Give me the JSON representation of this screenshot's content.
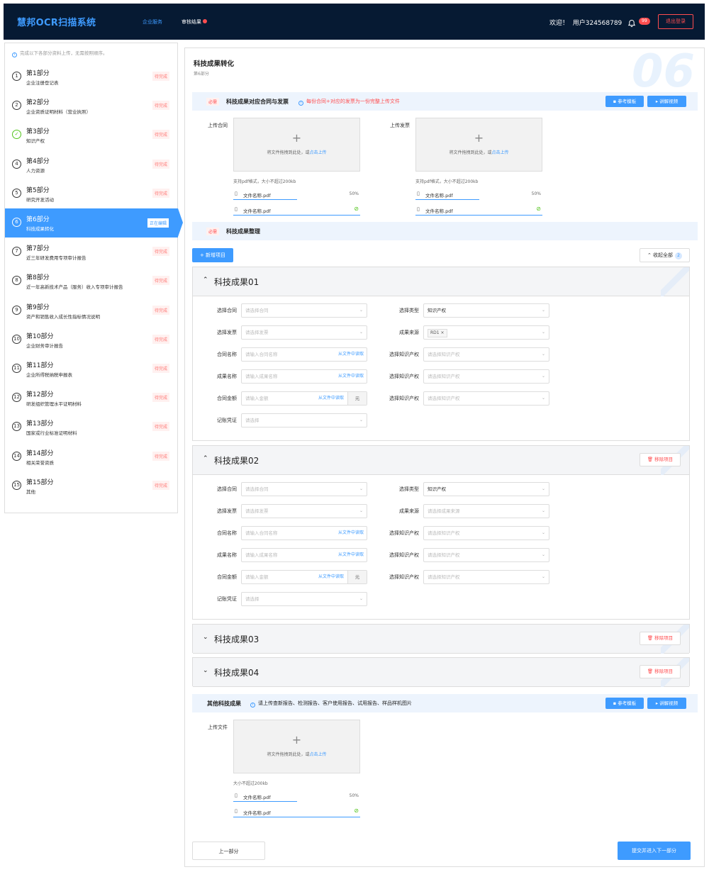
{
  "header": {
    "logo": "慧邦OCR扫描系统",
    "nav": [
      {
        "label": "企业服务",
        "active": true
      },
      {
        "label": "审核结果",
        "active": false
      }
    ],
    "welcome": "欢迎！",
    "user": "用户324568789",
    "badge": "99",
    "logout": "退出登录"
  },
  "sidebar": {
    "tip": "完成以下各部分资料上传，无需按照顺序。",
    "items": [
      {
        "num": "1",
        "title": "第1部分",
        "sub": "企业注册登记表",
        "status": "待完成"
      },
      {
        "num": "2",
        "title": "第2部分",
        "sub": "企业资质证明材料（营业执照）",
        "status": "待完成"
      },
      {
        "num": "✓",
        "title": "第3部分",
        "sub": "知识产权",
        "status": "待完成",
        "done": true
      },
      {
        "num": "4",
        "title": "第4部分",
        "sub": "人力资源",
        "status": "待完成"
      },
      {
        "num": "5",
        "title": "第5部分",
        "sub": "研究开发活动",
        "status": "待完成"
      },
      {
        "num": "6",
        "title": "第6部分",
        "sub": "科技成果转化",
        "status": "正在编辑",
        "active": true
      },
      {
        "num": "7",
        "title": "第7部分",
        "sub": "近三年研发费用专项审计报告",
        "status": "待完成"
      },
      {
        "num": "8",
        "title": "第8部分",
        "sub": "近一年高新技术产品（服务）收入专项审计报告",
        "status": "待完成"
      },
      {
        "num": "9",
        "title": "第9部分",
        "sub": "资产和销售收入成长性指标情况说明",
        "status": "待完成"
      },
      {
        "num": "10",
        "title": "第10部分",
        "sub": "企业财务审计报告",
        "status": "待完成"
      },
      {
        "num": "11",
        "title": "第11部分",
        "sub": "企业所得税纳税申报表",
        "status": "待完成"
      },
      {
        "num": "12",
        "title": "第12部分",
        "sub": "研发组织管理水平证明材料",
        "status": "待完成"
      },
      {
        "num": "13",
        "title": "第13部分",
        "sub": "国家或行业标准证明材料",
        "status": "待完成"
      },
      {
        "num": "14",
        "title": "第14部分",
        "sub": "相关荣誉资质",
        "status": "待完成"
      },
      {
        "num": "15",
        "title": "第15部分",
        "sub": "其他",
        "status": "待完成"
      }
    ]
  },
  "panel": {
    "watermark": "06",
    "title": "科技成果转化",
    "subtitle": "第6部分",
    "sec1": {
      "required": "必需",
      "title": "科技成果对应合同与发票",
      "hint": "每份合同+对应的发票为一份完整上传文件",
      "ref": "参考模板",
      "video": "讲解视频"
    },
    "upload": {
      "contract_label": "上传合同",
      "invoice_label": "上传发票",
      "drop": "将文件拖拽到此处，或",
      "click": "点击上传",
      "hint": "支持pdf格式，大小不超过200kb",
      "file": "文件名称.pdf",
      "pct": "50%",
      "progress": 0.5
    },
    "sec2": {
      "required": "必需",
      "title": "科技成果整理"
    },
    "add": "+ 新增项目",
    "collapse": "收起全部",
    "collapse_count": "2",
    "labels": {
      "contract": "选择合同",
      "invoice": "选择发票",
      "cname": "合同名称",
      "rname": "成果名称",
      "amount": "合同金额",
      "voucher": "记账凭证",
      "type": "选择类型",
      "source": "成果来源",
      "ip": "选择知识产权"
    },
    "ph": {
      "contract": "请选择合同",
      "invoice": "请选择发票",
      "cname": "请输入合同名称",
      "rname": "请输入成果名称",
      "amount": "请输入金额",
      "voucher": "请选择",
      "source": "请选择成果来源",
      "ip": "请选择知识产权"
    },
    "read": "从文件中读取",
    "unit": "元",
    "type_val": "知识产权",
    "source_tag": "RD1",
    "projects": [
      "科技成果01",
      "科技成果02",
      "科技成果03",
      "科技成果04"
    ],
    "remove": "移除项目",
    "sec3": {
      "title": "其他科技成果",
      "hint": "请上传查新报告、检测报告、客户使用报告、试用报告、样品样机图片",
      "ref": "参考模板",
      "video": "讲解视频",
      "label": "上传文件",
      "hint2": "大小不超过200kb"
    },
    "prev": "上一部分",
    "next": "提交并进入下一部分"
  }
}
